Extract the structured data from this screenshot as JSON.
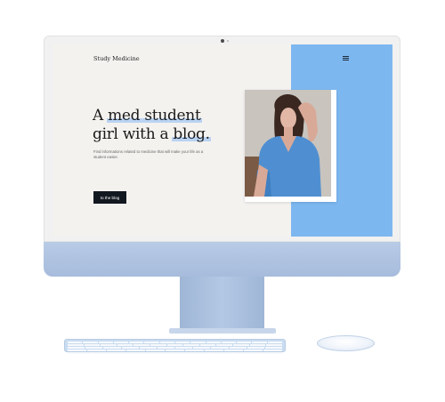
{
  "site": {
    "brand": "Study Medicine",
    "headline": {
      "part1": "A ",
      "highlight1": "med student",
      "part2": "girl with a ",
      "highlight2": "blog."
    },
    "subtitle": "Find informations related to medicine that will make your life as a student easier.",
    "cta_label": "to the blog"
  },
  "colors": {
    "accent_blue": "#7db7f0",
    "highlight": "#b9d3f2",
    "button": "#121820",
    "background": "#f4f2ef"
  },
  "icons": {
    "menu": "hamburger-menu-icon"
  }
}
